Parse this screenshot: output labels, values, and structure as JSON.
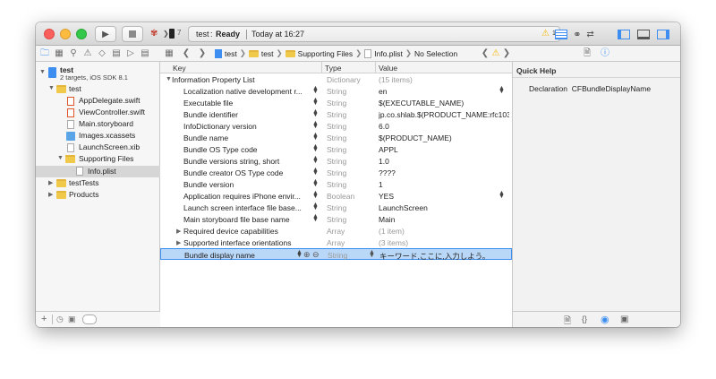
{
  "toolbar": {
    "scheme_target": "test",
    "status_label": "Ready",
    "status_time": "Today at 16:27",
    "warning_count": "1"
  },
  "jump_bar": {
    "project": "test",
    "group": "test",
    "subgroup": "Supporting Files",
    "file": "Info.plist",
    "selection": "No Selection"
  },
  "navigator": {
    "items": [
      {
        "label": "test",
        "sub": "2 targets, iOS SDK 8.1"
      },
      {
        "label": "test"
      },
      {
        "label": "AppDelegate.swift"
      },
      {
        "label": "ViewController.swift"
      },
      {
        "label": "Main.storyboard"
      },
      {
        "label": "Images.xcassets"
      },
      {
        "label": "LaunchScreen.xib"
      },
      {
        "label": "Supporting Files"
      },
      {
        "label": "Info.plist"
      },
      {
        "label": "testTests"
      },
      {
        "label": "Products"
      }
    ]
  },
  "plist": {
    "headers": {
      "key": "Key",
      "type": "Type",
      "value": "Value"
    },
    "root": {
      "key": "Information Property List",
      "type": "Dictionary",
      "value": "(15 items)"
    },
    "rows": [
      {
        "key": "Localization native development r...",
        "type": "String",
        "value": "en"
      },
      {
        "key": "Executable file",
        "type": "String",
        "value": "$(EXECUTABLE_NAME)"
      },
      {
        "key": "Bundle identifier",
        "type": "String",
        "value": "jp.co.shlab.$(PRODUCT_NAME:rfc103"
      },
      {
        "key": "InfoDictionary version",
        "type": "String",
        "value": "6.0"
      },
      {
        "key": "Bundle name",
        "type": "String",
        "value": "$(PRODUCT_NAME)"
      },
      {
        "key": "Bundle OS Type code",
        "type": "String",
        "value": "APPL"
      },
      {
        "key": "Bundle versions string, short",
        "type": "String",
        "value": "1.0"
      },
      {
        "key": "Bundle creator OS Type code",
        "type": "String",
        "value": "????"
      },
      {
        "key": "Bundle version",
        "type": "String",
        "value": "1"
      },
      {
        "key": "Application requires iPhone envir...",
        "type": "Boolean",
        "value": "YES"
      },
      {
        "key": "Launch screen interface file base...",
        "type": "String",
        "value": "LaunchScreen"
      },
      {
        "key": "Main storyboard file base name",
        "type": "String",
        "value": "Main"
      },
      {
        "key": "Required device capabilities",
        "type": "Array",
        "value": "(1 item)"
      },
      {
        "key": "Supported interface orientations",
        "type": "Array",
        "value": "(3 items)"
      },
      {
        "key": "Bundle display name",
        "type": "String",
        "value": "キーワード,ここに,入力しよう。"
      }
    ]
  },
  "inspector": {
    "title": "Quick Help",
    "declaration_label": "Declaration",
    "declaration_value": "CFBundleDisplayName"
  },
  "colors": {
    "accent": "#3d8ef0",
    "selection": "#b9d7f7",
    "folder": "#f0c94b",
    "warning": "#f5b700"
  }
}
